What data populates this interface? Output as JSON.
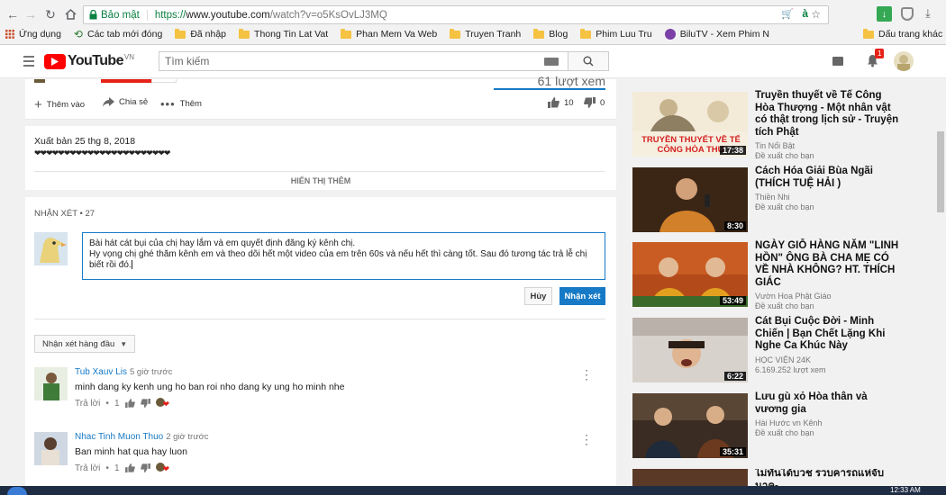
{
  "browser": {
    "secure_label": "Bảo mật",
    "url_scheme": "https://",
    "url_host": "www.youtube.com",
    "url_path": "/watch?v=o5KsOvLJ3MQ",
    "bookmarks": [
      "Ứng dụng",
      "Các tab mới đóng",
      "Đã nhập",
      "Thong Tin Lat Vat",
      "Phan Mem Va Web",
      "Truyen Tranh",
      "Blog",
      "Phim Luu Tru",
      "BiluTV - Xem Phim N",
      "Dấu trang khác"
    ]
  },
  "youtube": {
    "logo_text": "YouTube",
    "logo_region": "VN",
    "search_placeholder": "Tìm kiếm",
    "notif_count": "1"
  },
  "video": {
    "views_text": "61 lượt xem",
    "add_label": "Thêm vào",
    "share_label": "Chia sẻ",
    "more_label": "Thêm",
    "likes": "10",
    "dislikes": "0"
  },
  "description": {
    "published": "Xuất bản 25 thg 8, 2018",
    "hearts": "❤❤❤❤❤❤❤❤❤❤❤❤❤❤❤❤❤❤❤❤❤❤❤",
    "show_more": "HIỂN THỊ THÊM"
  },
  "comments": {
    "header": "NHẬN XÉT • 27",
    "draft_line1": "Bài hát cát bụi của chị hay lắm và em quyết định đăng ký kênh chị.",
    "draft_line2": "Hy vọng chị ghé thăm kênh em và theo dõi hết một video của em trên 60s và nếu hết thì càng tốt. Sau đó tương tác trả lễ chị",
    "draft_line3": "biết rồi đó.",
    "cancel_label": "Hủy",
    "submit_label": "Nhận xét",
    "sort_label": "Nhận xét hàng đầu",
    "items": [
      {
        "author": "Tub Xauv Lis",
        "time": "5 giờ trước",
        "text": "minh dang ky kenh ung ho ban roi nho dang ky ung ho minh nhe",
        "reply": "Trả lời",
        "likes": "1"
      },
      {
        "author": "Nhac Tinh Muon Thuo",
        "time": "2 giờ trước",
        "text": "Ban minh hat qua hay luon",
        "reply": "Trả lời",
        "likes": "1"
      }
    ]
  },
  "sidebar": {
    "items": [
      {
        "title": "Truyền thuyết về Tế Công Hòa Thượng - Một nhân vật có thật trong lịch sử - Truyện tích Phật",
        "channel": "Tin Nổi Bật",
        "meta": "Đề xuất cho bạn",
        "duration": "17:38",
        "thumb_text": "TRUYỀN THUYẾT VỀ TẾ CÔNG HÒA THƯ"
      },
      {
        "title": "Cách Hóa Giải Bùa Ngãi (THÍCH TUỆ HẢI )",
        "channel": "Thiền Nhi",
        "meta": "Đề xuất cho bạn",
        "duration": "8:30"
      },
      {
        "title": "NGÀY GIỖ HÀNG NĂM \"LINH HỒN\" ÔNG BÀ CHA MẸ CÓ VỀ NHÀ KHÔNG? HT. THÍCH GIÁC",
        "channel": "Vườn Hoa Phật Giáo",
        "meta": "Đề xuất cho bạn",
        "duration": "53:49"
      },
      {
        "title": "Cát Bụi Cuộc Đời - Minh Chiến | Bạn Chết Lặng Khi Nghe Ca Khúc Này",
        "channel": "HỌC VIỆN 24K",
        "meta": "6.169.252 lượt xem",
        "duration": "6:22"
      },
      {
        "title": "Lưu gù xỏ Hòa thân và vương gia",
        "channel": "Hài Hước vn Kênh",
        "meta": "Đề xuất cho bạn",
        "duration": "35:31"
      },
      {
        "title": "ไม่ทันได้บวช รวบคารถแห่จับนาค-",
        "channel": "",
        "meta": "",
        "duration": ""
      }
    ]
  },
  "taskbar": {
    "clock": "12:33 AM"
  },
  "colors": {
    "youtube_red": "#ff0000",
    "link_blue": "#167ac6",
    "secure_green": "#0b8043"
  }
}
